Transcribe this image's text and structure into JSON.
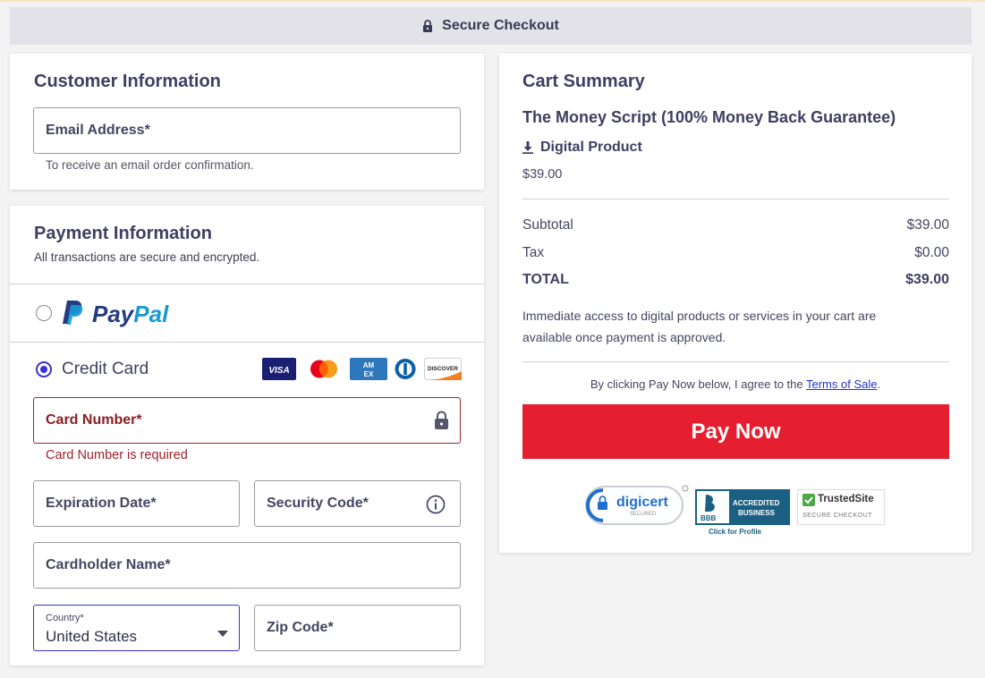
{
  "header": {
    "title": "Secure Checkout",
    "icon": "lock-icon"
  },
  "customer": {
    "title": "Customer Information",
    "email_label": "Email Address*",
    "email_helper": "To receive an email order confirmation."
  },
  "payment": {
    "title": "Payment Information",
    "subtitle": "All transactions are secure and encrypted.",
    "paypal": {
      "pay": "Pay",
      "pal": "Pal",
      "selected": false
    },
    "credit_card": {
      "label": "Credit Card",
      "selected": true,
      "brands": [
        "VISA",
        "mastercard",
        "AMEX",
        "diners",
        "DISCOVER"
      ]
    },
    "card_number_label": "Card Number*",
    "card_number_error": "Card Number is required",
    "expiration_label": "Expiration Date*",
    "security_code_label": "Security Code*",
    "cardholder_label": "Cardholder Name*",
    "country_label": "Country*",
    "country_value": "United States",
    "zip_label": "Zip Code*"
  },
  "cart": {
    "title": "Cart Summary",
    "product_name": "The Money Script (100% Money Back Guarantee)",
    "product_type": "Digital Product",
    "product_price": "$39.00",
    "subtotal_label": "Subtotal",
    "subtotal_value": "$39.00",
    "tax_label": "Tax",
    "tax_value": "$0.00",
    "total_label": "TOTAL",
    "total_value": "$39.00",
    "access_note_line1": "Immediate access to digital products or services in your cart are",
    "access_note_line2": "available once payment is approved.",
    "terms_prefix": "By clicking Pay Now below, I agree to the ",
    "terms_link": "Terms of Sale",
    "terms_suffix": ".",
    "pay_button": "Pay Now",
    "badges": {
      "digicert": "digicert",
      "digicert_sub": "SECURED",
      "bbb_line1": "ACCREDITED",
      "bbb_line2": "BUSINESS",
      "bbb_short": "BBB",
      "bbb_link": "Click for Profile",
      "trusted": "TrustedSite",
      "trusted_sub": "SECURE CHECKOUT"
    }
  },
  "colors": {
    "accent": "#3b31d6",
    "pay_button": "#e51f2f",
    "error": "#9d2228",
    "paypal_dark": "#253b80",
    "paypal_light": "#179bd7"
  }
}
